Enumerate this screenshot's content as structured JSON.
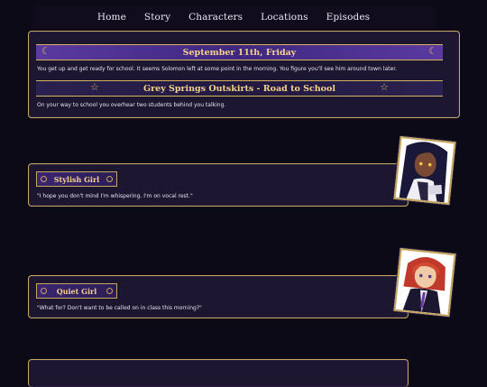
{
  "nav": {
    "items": [
      "Home",
      "Story",
      "Characters",
      "Locations",
      "Episodes"
    ]
  },
  "scene": {
    "date_banner": "September 11th, Friday",
    "intro_text": "You get up and get ready for school. It seems Solomon left at some point in the morning. You figure you'll see him around town later.",
    "location_banner": "Grey Springs Outskirts - Road to School",
    "location_text": "On your way to school you overhear two students behind you talking."
  },
  "dialogues": [
    {
      "speaker": "Stylish Girl",
      "line": "\"I hope you don't mind I'm whispering. I'm on vocal rest.\""
    },
    {
      "speaker": "Quiet Girl",
      "line": "\"What for? Don't want to be called on in class this morning?\""
    }
  ],
  "colors": {
    "background": "#0d0a17",
    "card": "#1c1630",
    "gold": "#c6a65c",
    "banner_purple": "#4a2f90",
    "text": "#e8e2f0"
  },
  "icons": {
    "date_left": "moon-icon",
    "date_right": "moon-icon",
    "location_left": "star-icon",
    "location_right": "star-icon"
  }
}
